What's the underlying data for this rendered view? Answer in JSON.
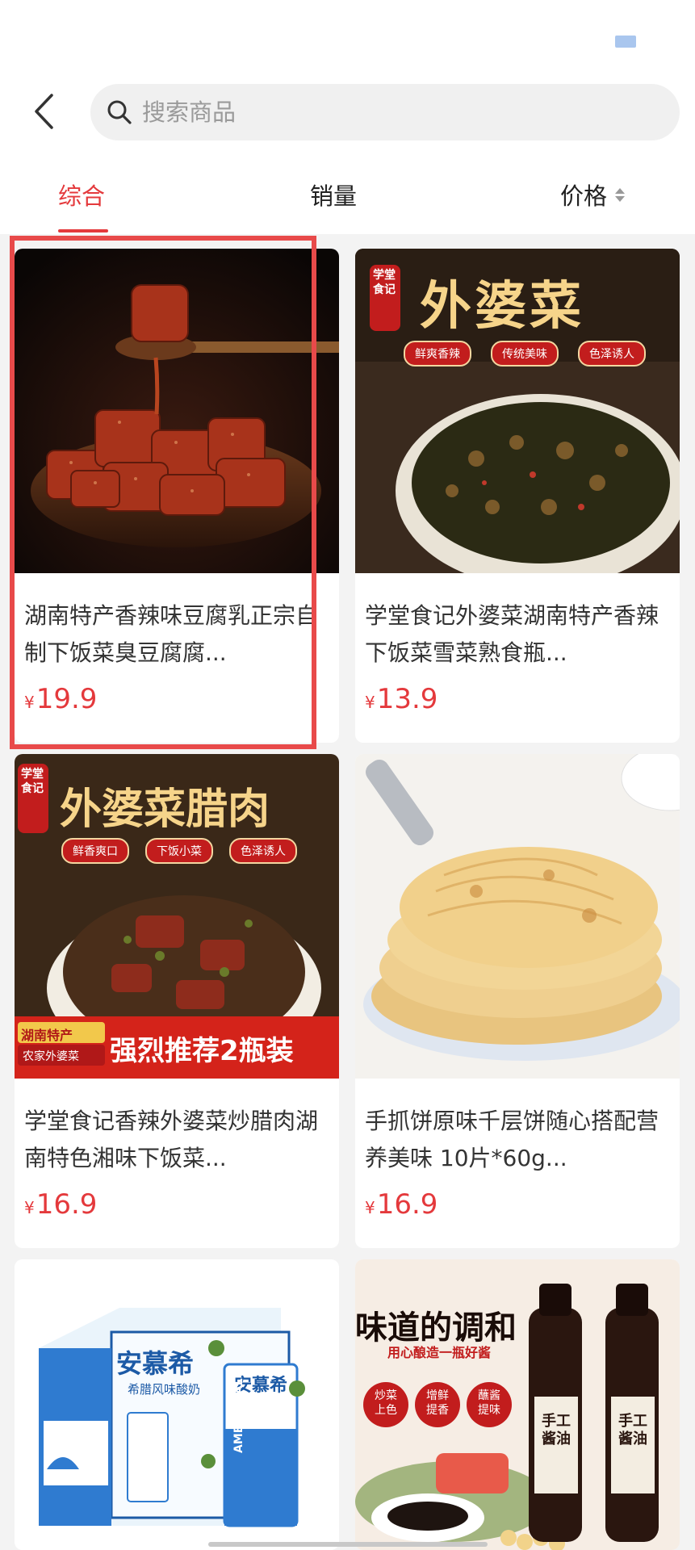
{
  "header": {
    "search_placeholder": "搜索商品"
  },
  "tabs": [
    {
      "label": "综合",
      "active": true
    },
    {
      "label": "销量",
      "active": false
    },
    {
      "label": "价格",
      "active": false
    }
  ],
  "currency_symbol": "¥",
  "products": [
    {
      "title": "湖南特产香辣味豆腐乳正宗自制下饭菜臭豆腐腐...",
      "price": "19.9"
    },
    {
      "title": "学堂食记外婆菜湖南特产香辣下饭菜雪菜熟食瓶...",
      "price": "13.9",
      "image_text": {
        "badge": "学堂食记",
        "headline": "外婆菜",
        "tags": [
          "鲜爽香辣",
          "传统美味",
          "色泽诱人"
        ]
      }
    },
    {
      "title": "学堂食记香辣外婆菜炒腊肉湖南特色湘味下饭菜...",
      "price": "16.9",
      "image_text": {
        "badge": "学堂食记",
        "headline": "外婆菜腊肉",
        "tags": [
          "鲜香爽口",
          "下饭小菜",
          "色泽诱人"
        ],
        "corner_top": "湖南特产",
        "corner_bottom": "农家外婆菜",
        "banner": "强烈推荐2瓶装"
      }
    },
    {
      "title": "手抓饼原味千层饼随心搭配营养美味 10片*60g...",
      "price": "16.9"
    },
    {
      "title": "",
      "price": "",
      "image_text": {
        "brand": "安慕希",
        "subtitle": "希腊风味酸奶",
        "side_brand": "AMBPOSIAL"
      }
    },
    {
      "title": "",
      "price": "",
      "image_text": {
        "headline": "味道的调和",
        "sub": "用心酿造一瓶好酱",
        "circles": [
          "炒菜上色",
          "增鲜提香",
          "蘸酱提味"
        ],
        "label": "手工酱油"
      }
    }
  ],
  "colors": {
    "accent": "#e4393c",
    "highlight": "#e84a4a"
  }
}
